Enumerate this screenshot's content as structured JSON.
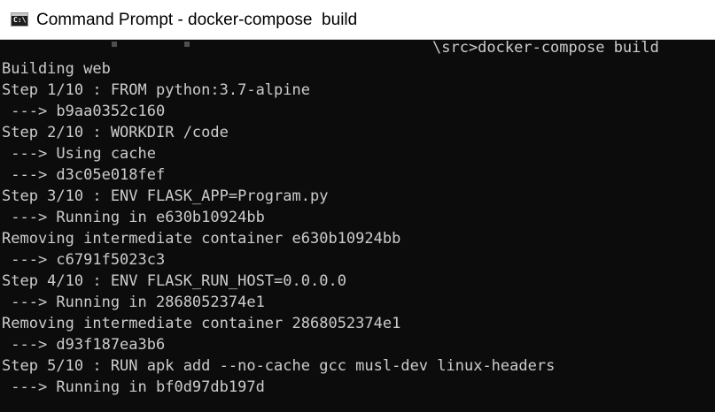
{
  "window": {
    "title": "Command Prompt - docker-compose  build",
    "icon": "cmd-app-icon",
    "icon_glyph": "C:\\"
  },
  "console": {
    "prompt_tail": "\\src>docker-compose build",
    "lines": [
      "Building web",
      "Step 1/10 : FROM python:3.7-alpine",
      " ---> b9aa0352c160",
      "Step 2/10 : WORKDIR /code",
      " ---> Using cache",
      " ---> d3c05e018fef",
      "Step 3/10 : ENV FLASK_APP=Program.py",
      " ---> Running in e630b10924bb",
      "Removing intermediate container e630b10924bb",
      " ---> c6791f5023c3",
      "Step 4/10 : ENV FLASK_RUN_HOST=0.0.0.0",
      " ---> Running in 2868052374e1",
      "Removing intermediate container 2868052374e1",
      " ---> d93f187ea3b6",
      "Step 5/10 : RUN apk add --no-cache gcc musl-dev linux-headers",
      " ---> Running in bf0d97db197d"
    ]
  },
  "colors": {
    "console_background": "#0c0c0c",
    "console_text": "#cccccc",
    "titlebar_background": "#ffffff",
    "title_text": "#000000"
  }
}
